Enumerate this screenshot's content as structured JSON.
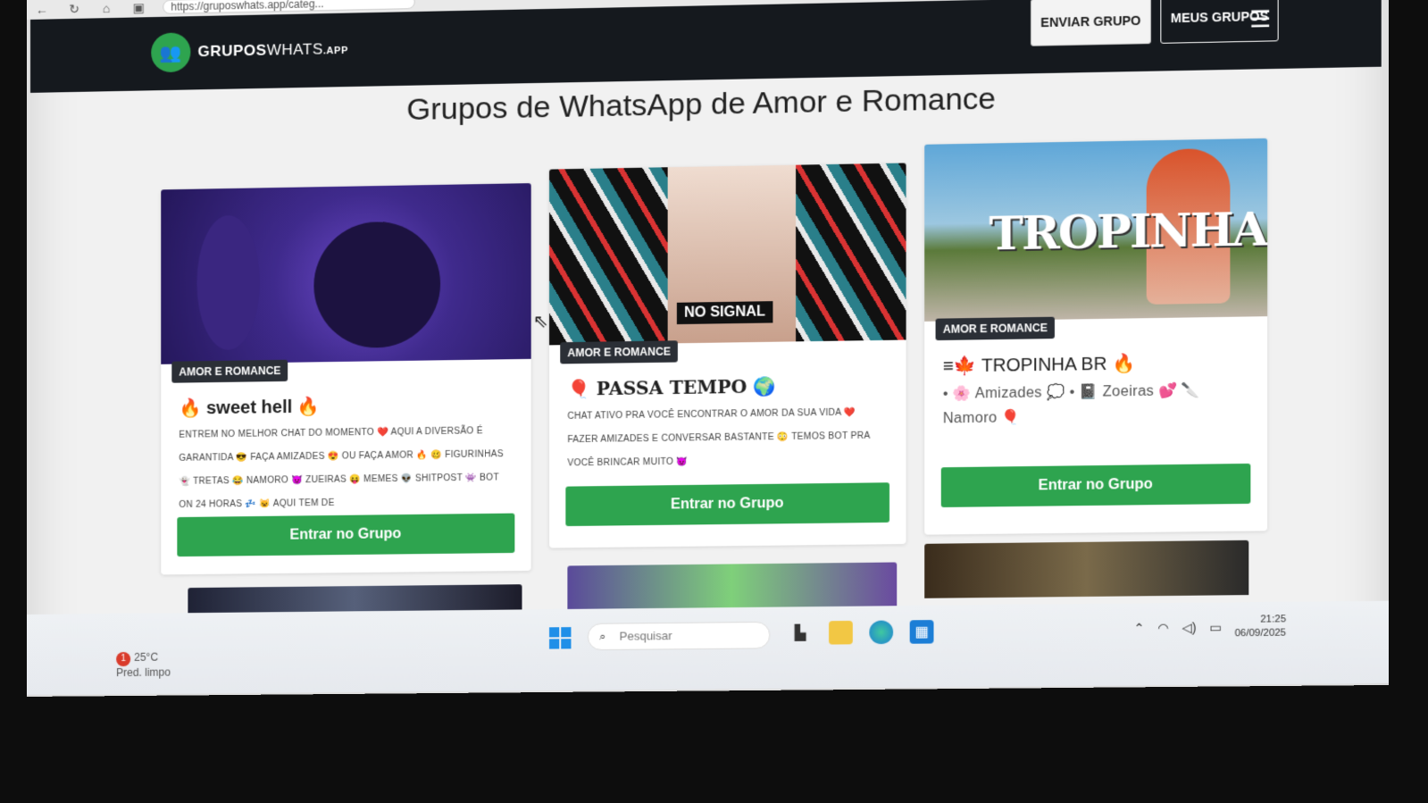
{
  "browser": {
    "url": "https://gruposwhats.app/categ..."
  },
  "navbar": {
    "logo_main": "GRUPOS",
    "logo_thin": "WHATS",
    "logo_suffix": ".APP",
    "send_label": "ENVIAR GRUPO",
    "mine_label": "MEUS GRUPOS"
  },
  "page": {
    "title": "Grupos de WhatsApp de Amor e Romance"
  },
  "cards": [
    {
      "tag": "AMOR E ROMANCE",
      "title": "🔥 sweet hell 🔥",
      "description": "ENTREM NO MELHOR CHAT DO MOMENTO ❤️ AQUI A DIVERSÃO É GARANTIDA 😎 FAÇA AMIZADES 😍 OU FAÇA AMOR 🔥 🥴 FIGURINHAS 👻 TRETAS 😂 NAMORO 😈 ZUEIRAS 😝 MEMES 👽 SHITPOST 👾 BOT ON 24 HORAS 💤 😺 AQUI TEM DE",
      "button": "Entrar no Grupo"
    },
    {
      "tag": "AMOR E ROMANCE",
      "title": "🎈 PASSA TEMPO 🌍",
      "description": "CHAT ATIVO PRA VOCÊ ENCONTRAR O AMOR DA SUA VIDA ❤️ FAZER AMIZADES E CONVERSAR BASTANTE 😳 TEMOS BOT PRA VOCÊ BRINCAR MUITO 😈",
      "image_label": "NO SIGNAL",
      "button": "Entrar no Grupo"
    },
    {
      "tag": "AMOR E ROMANCE",
      "title": "≡🍁 TROPINHA BR 🔥",
      "description": "• 🌸 Amizades 💭 • 📓 Zoeiras 💕 🔪 Namoro 🎈",
      "image_label": "TROPINHA",
      "button": "Entrar no Grupo"
    }
  ],
  "taskbar": {
    "weather_temp": "25°C",
    "weather_desc": "Pred. limpo",
    "weather_badge": "1",
    "search_placeholder": "Pesquisar",
    "time": "21:25",
    "date": "06/09/2025"
  },
  "icons": [
    "back-arrow-icon",
    "reload-icon",
    "home-icon",
    "site-info-icon",
    "whatsapp-group-icon",
    "hamburger-menu-icon",
    "windows-start-icon",
    "search-icon",
    "task-view-icon",
    "file-explorer-icon",
    "edge-browser-icon",
    "store-icon",
    "chevron-up-icon",
    "wifi-icon",
    "volume-icon",
    "battery-icon",
    "mouse-cursor-icon"
  ],
  "colors": {
    "brand_green": "#2ea44f",
    "navbar": "#15191e",
    "tag": "#2b2f36"
  }
}
